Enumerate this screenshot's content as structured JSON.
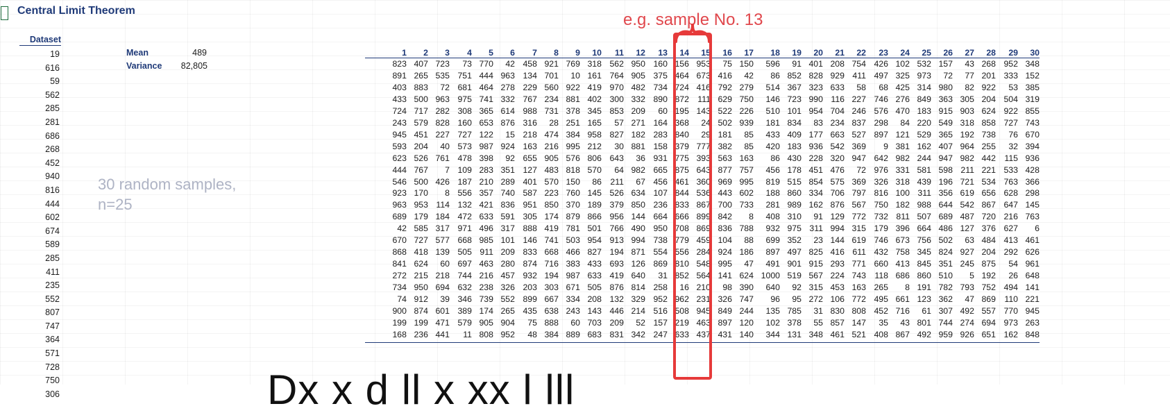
{
  "sheet": {
    "title": "Central Limit Theorem",
    "dataset_header": "Dataset",
    "dataset_values": [
      "19",
      "616",
      "59",
      "562",
      "285",
      "281",
      "686",
      "268",
      "452",
      "940",
      "816",
      "444",
      "602",
      "674",
      "589",
      "285",
      "411",
      "235",
      "552",
      "807",
      "747",
      "364",
      "571",
      "728",
      "750",
      "306"
    ],
    "mean_label": "Mean",
    "mean_value": "489",
    "variance_label": "Variance",
    "variance_value": "82,805"
  },
  "annotations": {
    "samples_note": "30 random samples,",
    "samples_n": "n=25",
    "highlight_note": "e.g. sample No. 13",
    "bottom_partial": "Dx x d ll x xx l lll"
  },
  "colors": {
    "header_blue": "#1f3a78",
    "annotation_red": "#e0474c",
    "annotation_gray": "#aeb3c4"
  },
  "samples": {
    "headers": [
      "1",
      "2",
      "3",
      "4",
      "5",
      "6",
      "7",
      "8",
      "9",
      "10",
      "11",
      "12",
      "13",
      "14",
      "15",
      "16",
      "17",
      "18",
      "19",
      "20",
      "21",
      "22",
      "23",
      "24",
      "25",
      "26",
      "27",
      "28",
      "29",
      "30"
    ],
    "rows": [
      [
        "823",
        "407",
        "723",
        "73",
        "770",
        "42",
        "458",
        "921",
        "769",
        "318",
        "562",
        "950",
        "160",
        "156",
        "953",
        "75",
        "150",
        "596",
        "91",
        "401",
        "208",
        "754",
        "426",
        "102",
        "532",
        "157",
        "43",
        "268",
        "952",
        "348"
      ],
      [
        "891",
        "265",
        "535",
        "751",
        "444",
        "963",
        "134",
        "701",
        "10",
        "161",
        "764",
        "905",
        "375",
        "464",
        "673",
        "416",
        "42",
        "86",
        "852",
        "828",
        "929",
        "411",
        "497",
        "325",
        "973",
        "72",
        "77",
        "201",
        "333",
        "152"
      ],
      [
        "403",
        "883",
        "72",
        "681",
        "464",
        "278",
        "229",
        "560",
        "922",
        "419",
        "970",
        "482",
        "734",
        "724",
        "416",
        "792",
        "279",
        "514",
        "367",
        "323",
        "633",
        "58",
        "68",
        "425",
        "314",
        "980",
        "82",
        "922",
        "53",
        "385"
      ],
      [
        "433",
        "500",
        "963",
        "975",
        "741",
        "332",
        "767",
        "234",
        "881",
        "402",
        "300",
        "332",
        "890",
        "872",
        "111",
        "629",
        "750",
        "146",
        "723",
        "990",
        "116",
        "227",
        "746",
        "276",
        "849",
        "363",
        "305",
        "204",
        "504",
        "319"
      ],
      [
        "724",
        "717",
        "282",
        "308",
        "365",
        "614",
        "988",
        "731",
        "378",
        "345",
        "853",
        "209",
        "60",
        "195",
        "143",
        "522",
        "226",
        "510",
        "101",
        "954",
        "704",
        "246",
        "576",
        "470",
        "183",
        "915",
        "903",
        "624",
        "922",
        "855"
      ],
      [
        "243",
        "579",
        "828",
        "160",
        "653",
        "876",
        "316",
        "28",
        "251",
        "165",
        "57",
        "271",
        "164",
        "368",
        "24",
        "502",
        "939",
        "181",
        "834",
        "83",
        "234",
        "837",
        "298",
        "84",
        "220",
        "549",
        "318",
        "858",
        "727",
        "743"
      ],
      [
        "945",
        "451",
        "227",
        "727",
        "122",
        "15",
        "218",
        "474",
        "384",
        "958",
        "827",
        "182",
        "283",
        "840",
        "29",
        "181",
        "85",
        "433",
        "409",
        "177",
        "663",
        "527",
        "897",
        "121",
        "529",
        "365",
        "192",
        "738",
        "76",
        "670"
      ],
      [
        "593",
        "204",
        "40",
        "573",
        "987",
        "924",
        "163",
        "216",
        "995",
        "212",
        "30",
        "881",
        "158",
        "379",
        "777",
        "382",
        "85",
        "420",
        "183",
        "936",
        "542",
        "369",
        "9",
        "381",
        "162",
        "407",
        "964",
        "255",
        "32",
        "394"
      ],
      [
        "623",
        "526",
        "761",
        "478",
        "398",
        "92",
        "655",
        "905",
        "576",
        "806",
        "643",
        "36",
        "931",
        "775",
        "393",
        "563",
        "163",
        "86",
        "430",
        "228",
        "320",
        "947",
        "642",
        "982",
        "244",
        "947",
        "982",
        "442",
        "115",
        "936"
      ],
      [
        "444",
        "767",
        "7",
        "109",
        "283",
        "351",
        "127",
        "483",
        "818",
        "570",
        "64",
        "982",
        "665",
        "875",
        "643",
        "877",
        "757",
        "456",
        "178",
        "451",
        "476",
        "72",
        "976",
        "331",
        "581",
        "598",
        "211",
        "221",
        "533",
        "428"
      ],
      [
        "546",
        "500",
        "426",
        "187",
        "210",
        "289",
        "401",
        "570",
        "150",
        "86",
        "211",
        "67",
        "456",
        "461",
        "360",
        "969",
        "995",
        "819",
        "515",
        "854",
        "575",
        "369",
        "326",
        "318",
        "439",
        "196",
        "721",
        "534",
        "763",
        "366"
      ],
      [
        "923",
        "170",
        "8",
        "556",
        "357",
        "740",
        "587",
        "223",
        "760",
        "145",
        "526",
        "634",
        "107",
        "844",
        "536",
        "443",
        "602",
        "188",
        "860",
        "334",
        "706",
        "797",
        "816",
        "100",
        "311",
        "356",
        "619",
        "656",
        "628",
        "298"
      ],
      [
        "963",
        "953",
        "114",
        "132",
        "421",
        "836",
        "951",
        "850",
        "370",
        "189",
        "379",
        "850",
        "236",
        "833",
        "867",
        "700",
        "733",
        "281",
        "989",
        "162",
        "876",
        "567",
        "750",
        "182",
        "988",
        "644",
        "542",
        "867",
        "647",
        "145"
      ],
      [
        "689",
        "179",
        "184",
        "472",
        "633",
        "591",
        "305",
        "174",
        "879",
        "866",
        "956",
        "144",
        "664",
        "666",
        "899",
        "842",
        "8",
        "408",
        "310",
        "91",
        "129",
        "772",
        "732",
        "811",
        "507",
        "689",
        "487",
        "720",
        "216",
        "763"
      ],
      [
        "42",
        "585",
        "317",
        "971",
        "496",
        "317",
        "888",
        "419",
        "781",
        "501",
        "766",
        "490",
        "950",
        "708",
        "869",
        "836",
        "788",
        "932",
        "975",
        "311",
        "994",
        "315",
        "179",
        "396",
        "664",
        "486",
        "127",
        "376",
        "627",
        "6"
      ],
      [
        "670",
        "727",
        "577",
        "668",
        "985",
        "101",
        "146",
        "741",
        "503",
        "954",
        "913",
        "994",
        "738",
        "779",
        "459",
        "104",
        "88",
        "699",
        "352",
        "23",
        "144",
        "619",
        "746",
        "673",
        "756",
        "502",
        "63",
        "484",
        "413",
        "461"
      ],
      [
        "868",
        "418",
        "139",
        "505",
        "911",
        "209",
        "833",
        "668",
        "466",
        "827",
        "194",
        "871",
        "554",
        "556",
        "284",
        "924",
        "186",
        "897",
        "497",
        "825",
        "416",
        "611",
        "432",
        "758",
        "345",
        "824",
        "927",
        "204",
        "292",
        "626"
      ],
      [
        "841",
        "624",
        "60",
        "697",
        "463",
        "280",
        "874",
        "716",
        "383",
        "433",
        "693",
        "126",
        "869",
        "810",
        "548",
        "995",
        "47",
        "491",
        "901",
        "915",
        "293",
        "771",
        "660",
        "413",
        "845",
        "351",
        "245",
        "875",
        "54",
        "961"
      ],
      [
        "272",
        "215",
        "218",
        "744",
        "216",
        "457",
        "932",
        "194",
        "987",
        "633",
        "419",
        "640",
        "31",
        "852",
        "564",
        "141",
        "624",
        "1000",
        "519",
        "567",
        "224",
        "743",
        "118",
        "686",
        "860",
        "510",
        "5",
        "192",
        "26",
        "648"
      ],
      [
        "734",
        "950",
        "694",
        "632",
        "238",
        "326",
        "203",
        "303",
        "671",
        "505",
        "876",
        "814",
        "258",
        "16",
        "210",
        "98",
        "390",
        "640",
        "92",
        "315",
        "453",
        "163",
        "265",
        "8",
        "191",
        "782",
        "793",
        "752",
        "494",
        "141"
      ],
      [
        "74",
        "912",
        "39",
        "346",
        "739",
        "552",
        "899",
        "667",
        "334",
        "208",
        "132",
        "329",
        "952",
        "962",
        "231",
        "326",
        "747",
        "96",
        "95",
        "272",
        "106",
        "772",
        "495",
        "661",
        "123",
        "362",
        "47",
        "869",
        "110",
        "221"
      ],
      [
        "900",
        "874",
        "601",
        "389",
        "174",
        "265",
        "435",
        "638",
        "243",
        "143",
        "446",
        "214",
        "516",
        "508",
        "945",
        "849",
        "244",
        "135",
        "785",
        "31",
        "830",
        "808",
        "452",
        "716",
        "61",
        "307",
        "492",
        "557",
        "770",
        "945"
      ],
      [
        "199",
        "199",
        "471",
        "579",
        "905",
        "904",
        "75",
        "888",
        "60",
        "703",
        "209",
        "52",
        "157",
        "219",
        "463",
        "897",
        "120",
        "102",
        "378",
        "55",
        "857",
        "147",
        "35",
        "43",
        "801",
        "744",
        "274",
        "694",
        "973",
        "263"
      ],
      [
        "168",
        "236",
        "441",
        "11",
        "808",
        "952",
        "48",
        "384",
        "889",
        "683",
        "831",
        "342",
        "247",
        "633",
        "437",
        "431",
        "140",
        "344",
        "131",
        "348",
        "461",
        "521",
        "408",
        "867",
        "492",
        "959",
        "926",
        "651",
        "162",
        "848"
      ]
    ]
  }
}
